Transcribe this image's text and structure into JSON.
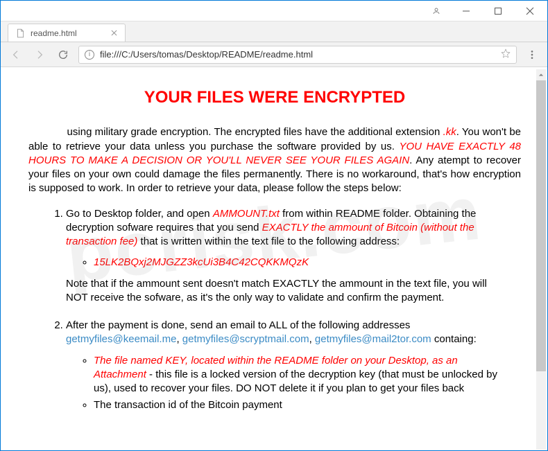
{
  "window": {},
  "tab": {
    "title": "readme.html"
  },
  "address": {
    "url": "file:///C:/Users/tomas/Desktop/README/readme.html"
  },
  "page": {
    "title": "YOUR FILES WERE ENCRYPTED",
    "intro_prefix": "using military grade encryption. The encrypted files have the additional extension ",
    "ext": ".kk",
    "intro_mid": ". You won't be able to retrieve your data unless you purchase the software provided by us. ",
    "deadline": "YOU HAVE EXACTLY 48 HOURS TO MAKE A DECISION OR YOU'LL NEVER SEE YOUR FILES AGAIN",
    "intro_tail": ". Any atempt to recover your files on your own could damage the files permanently. There is no workaround, that's how encryption is supposed to work. In order to retrieve your data, please follow the steps below:",
    "step1_a": "Go to Desktop folder, and open ",
    "step1_file": "AMMOUNT.txt",
    "step1_b": " from within README folder. Obtaining the decryption sofware requires that you send ",
    "step1_amt": "EXACTLY the ammount of Bitcoin (without the transaction fee)",
    "step1_c": " that is written within the text file to the following address:",
    "btc": "15LK2BQxj2MJGZZ3kcUi3B4C42CQKKMQzK",
    "note1": "Note that if the ammount sent doesn't match EXACTLY the ammount in the text file, you will NOT receive the sofware, as it's the only way to validate and confirm the payment.",
    "step2_a": "After the payment is done, send an email to ALL of the following addresses ",
    "email1": "getmyfiles@keemail.me",
    "email2": "getmyfiles@scryptmail.com",
    "email3": "getmyfiles@mail2tor.com",
    "step2_b": " containg:",
    "sub1_a": "The file named KEY, located within the README folder on your Desktop, as an Attachment",
    "sub1_b": " - this file is a locked version of the decryption key (that must be unlocked by us), used to recover your files. DO NOT delete it if you plan to get your files back",
    "sub2": "The transaction id of the Bitcoin payment"
  },
  "sep": {
    "comma": ", "
  },
  "indent": "             ",
  "watermark": "pcrisk.com"
}
